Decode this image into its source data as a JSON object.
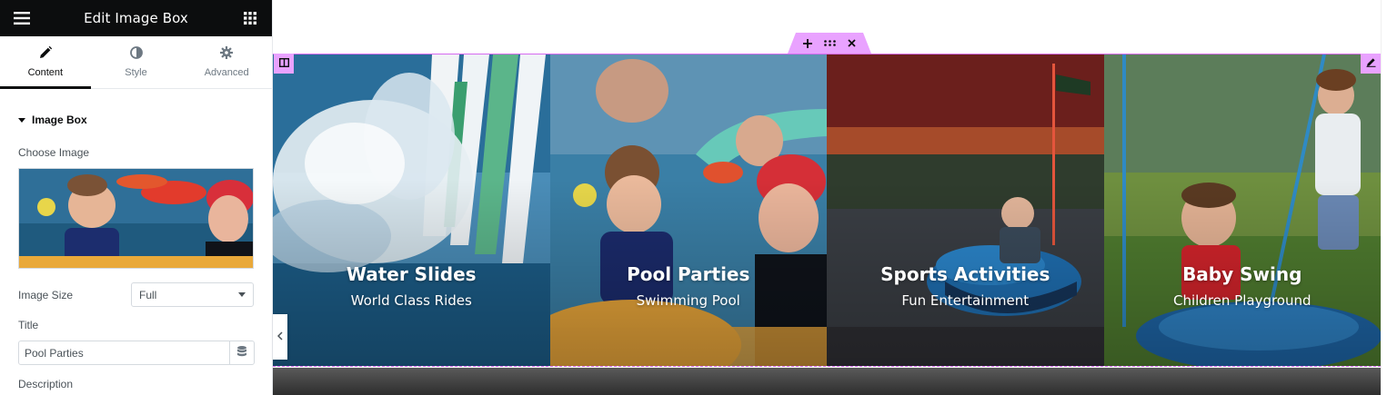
{
  "panel": {
    "header_title": "Edit Image Box",
    "tabs": [
      {
        "label": "Content",
        "icon": "pencil-icon",
        "active": true
      },
      {
        "label": "Style",
        "icon": "contrast-icon",
        "active": false
      },
      {
        "label": "Advanced",
        "icon": "gear-icon",
        "active": false
      }
    ],
    "section_title": "Image Box",
    "choose_image_label": "Choose Image",
    "image_size_label": "Image Size",
    "image_size_value": "Full",
    "title_label": "Title",
    "title_value": "Pool Parties",
    "description_label": "Description"
  },
  "image_boxes": [
    {
      "title": "Water Slides",
      "description": "World Class Rides"
    },
    {
      "title": "Pool Parties",
      "description": "Swimming Pool"
    },
    {
      "title": "Sports Activities",
      "description": "Fun Entertainment"
    },
    {
      "title": "Baby Swing",
      "description": "Children Playground"
    }
  ],
  "colors": {
    "panel_header": "#0c0d0e",
    "editor_accent": "#e9a2ff",
    "editor_outline": "#d56af0"
  }
}
